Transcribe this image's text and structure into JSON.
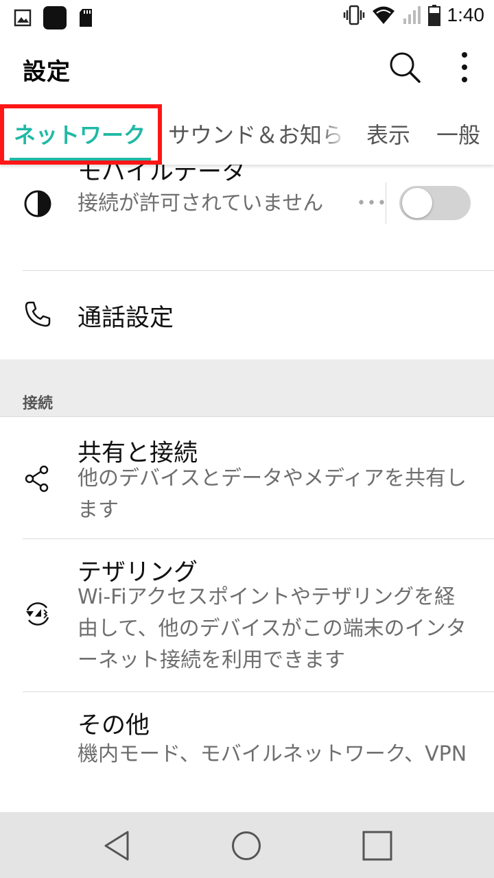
{
  "status_bar": {
    "time": "1:40",
    "left_icons": [
      "gallery-icon",
      "app-icon",
      "sdcard-icon"
    ],
    "right_icons": [
      "vibrate-icon",
      "wifi-icon",
      "signal-icon",
      "battery-icon"
    ]
  },
  "app_bar": {
    "title": "設定",
    "search_icon": "search-icon",
    "more_icon": "more-vert-icon"
  },
  "tabs": [
    {
      "label": "ネットワーク",
      "active": true
    },
    {
      "label": "サウンド＆お知ら",
      "active": false
    },
    {
      "label": "表示",
      "active": false
    },
    {
      "label": "一般",
      "active": false
    }
  ],
  "list": {
    "mobile_data": {
      "title": "モバイルデータ",
      "subtitle": "接続が許可されていません",
      "toggle_on": false,
      "icon": "mobile-data-icon"
    },
    "call_settings": {
      "title": "通話設定",
      "icon": "phone-icon"
    },
    "section_header": "接続",
    "share_connect": {
      "title": "共有と接続",
      "subtitle": "他のデバイスとデータやメディアを共有します",
      "icon": "share-icon"
    },
    "tethering": {
      "title": "テザリング",
      "subtitle": "Wi-Fiアクセスポイントやテザリングを経由して、他のデバイスがこの端末のインターネット接続を利用できます",
      "icon": "tethering-icon"
    },
    "others": {
      "title": "その他",
      "subtitle": "機内モード、モバイルネットワーク、VPN",
      "icon": ""
    }
  },
  "nav_bar": {
    "back_icon": "back-icon",
    "home_icon": "home-icon",
    "recents_icon": "recents-icon"
  },
  "colors": {
    "accent": "#20b9a5",
    "highlight": "#ff1616"
  }
}
